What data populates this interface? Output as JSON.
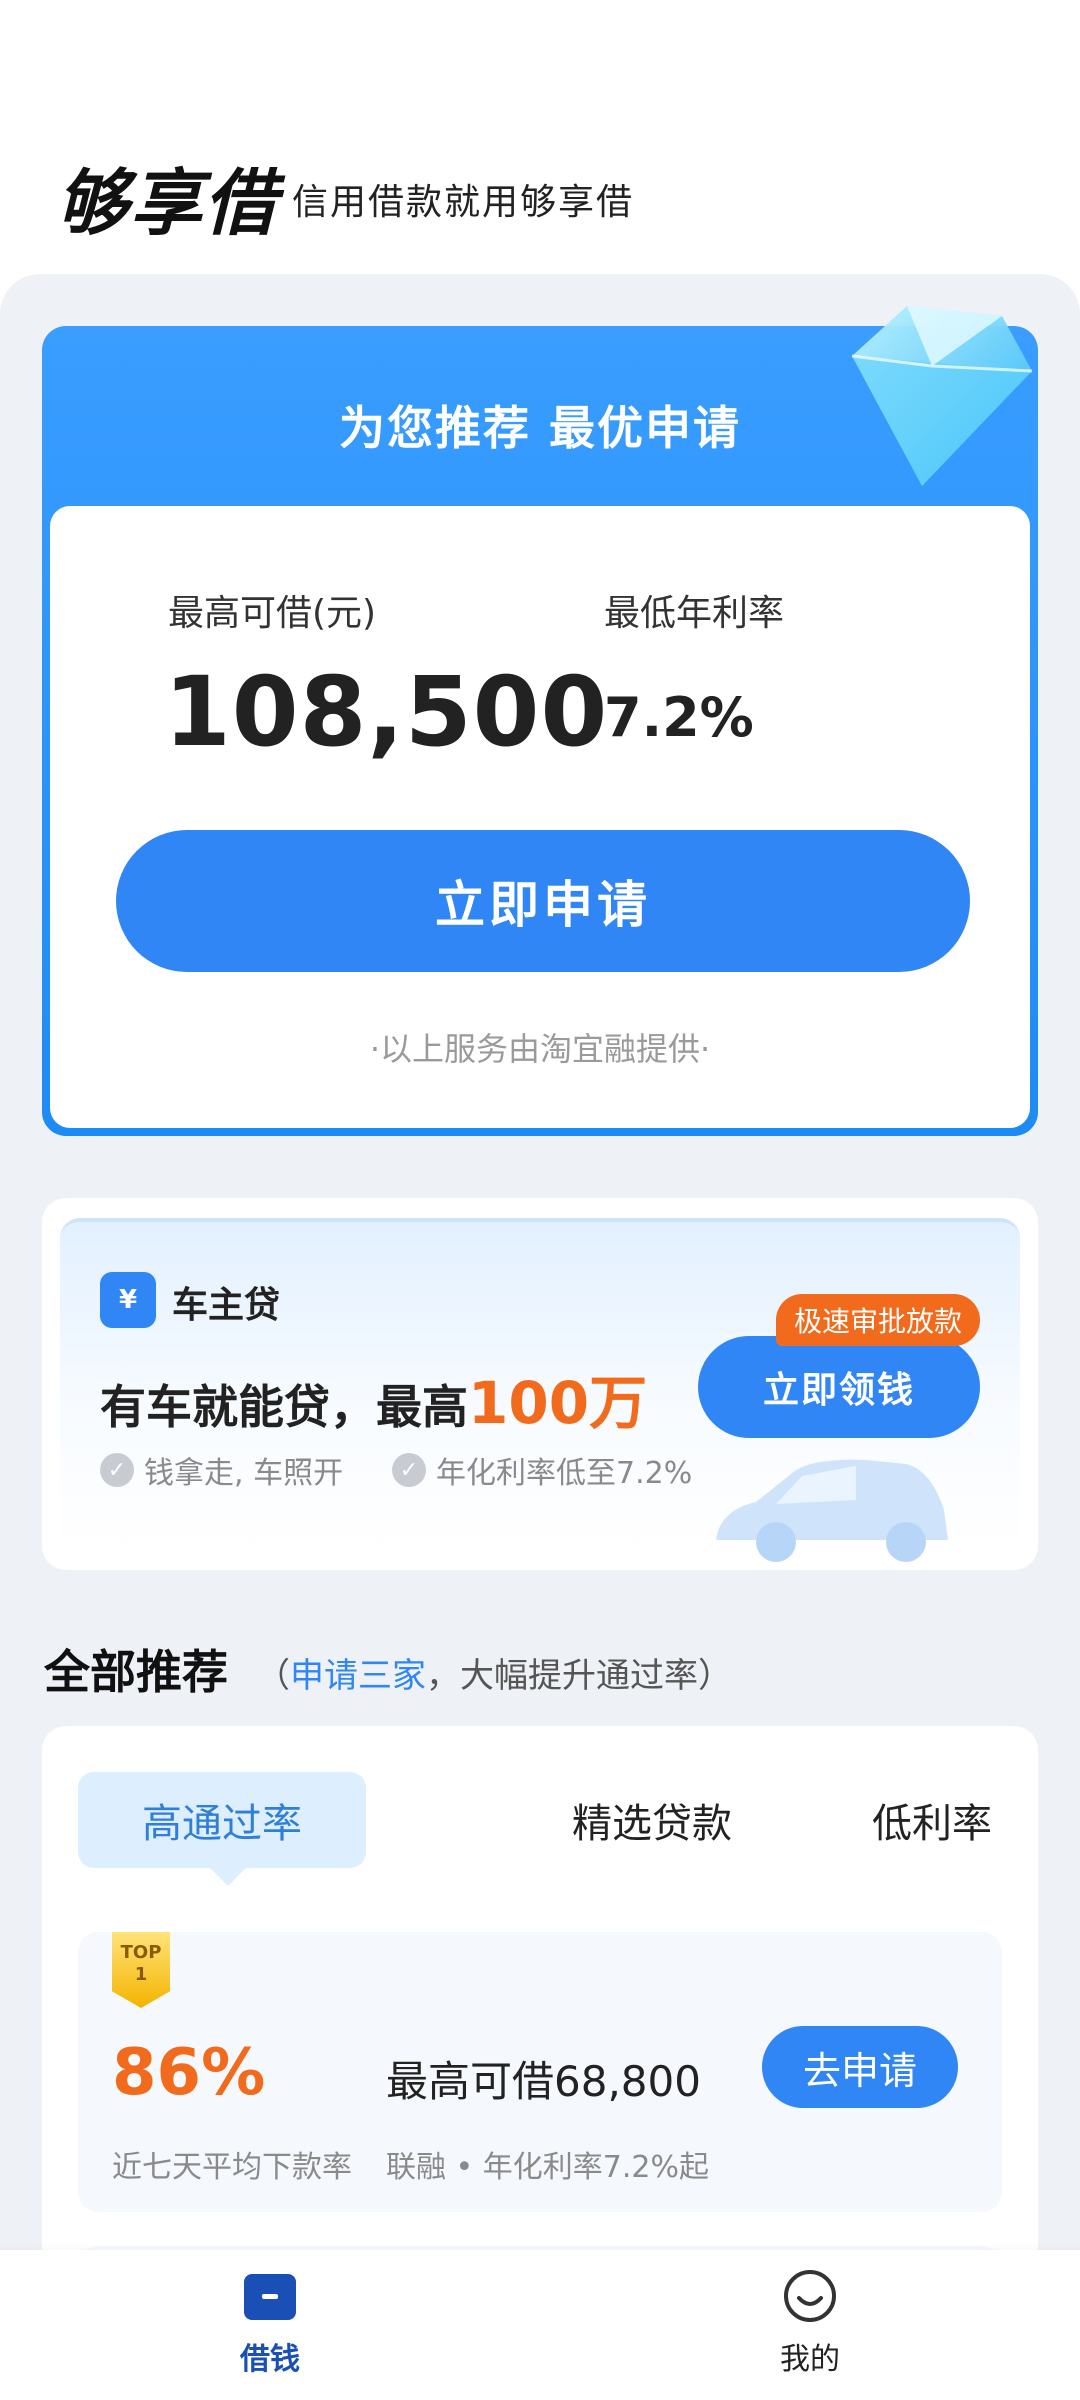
{
  "header": {
    "brand": "够享借",
    "slogan": "信用借款就用够享借"
  },
  "recommend": {
    "title": "为您推荐 最优申请",
    "max_label": "最高可借(元)",
    "max_value": "108,500",
    "rate_label": "最低年利率",
    "rate_value": "7.2%",
    "apply_label": "立即申请",
    "provider_note": "·以上服务由淘宜融提供·"
  },
  "car_loan": {
    "icon_text": "¥",
    "name": "车主贷",
    "headline_prefix": "有车就能贷，最高",
    "headline_amount": "100万",
    "badge": "极速审批放款",
    "cta_label": "立即领钱",
    "features": [
      "钱拿走, 车照开",
      "年化利率低至7.2%"
    ]
  },
  "section": {
    "title": "全部推荐",
    "sub_open": "（",
    "sub_highlight": "申请三家",
    "sub_rest": "，大幅提升通过率）"
  },
  "tabs": [
    {
      "label": "高通过率",
      "active": true
    },
    {
      "label": "精选贷款",
      "active": false
    },
    {
      "label": "低利率",
      "active": false
    }
  ],
  "products": [
    {
      "rank_badge_top": "TOP",
      "rank_badge_num": "1",
      "rate": "86%",
      "rate_caption": "近七天平均下款率",
      "limit_text": "最高可借68,800",
      "desc": "联融 • 年化利率7.2%起",
      "button": "去申请"
    }
  ],
  "bottom_nav": {
    "items": [
      {
        "label": "借钱",
        "active": true
      },
      {
        "label": "我的",
        "active": false
      }
    ]
  },
  "colors": {
    "primary": "#2f86f4",
    "accent": "#f26a1b",
    "nav_active": "#1a4fb5"
  }
}
